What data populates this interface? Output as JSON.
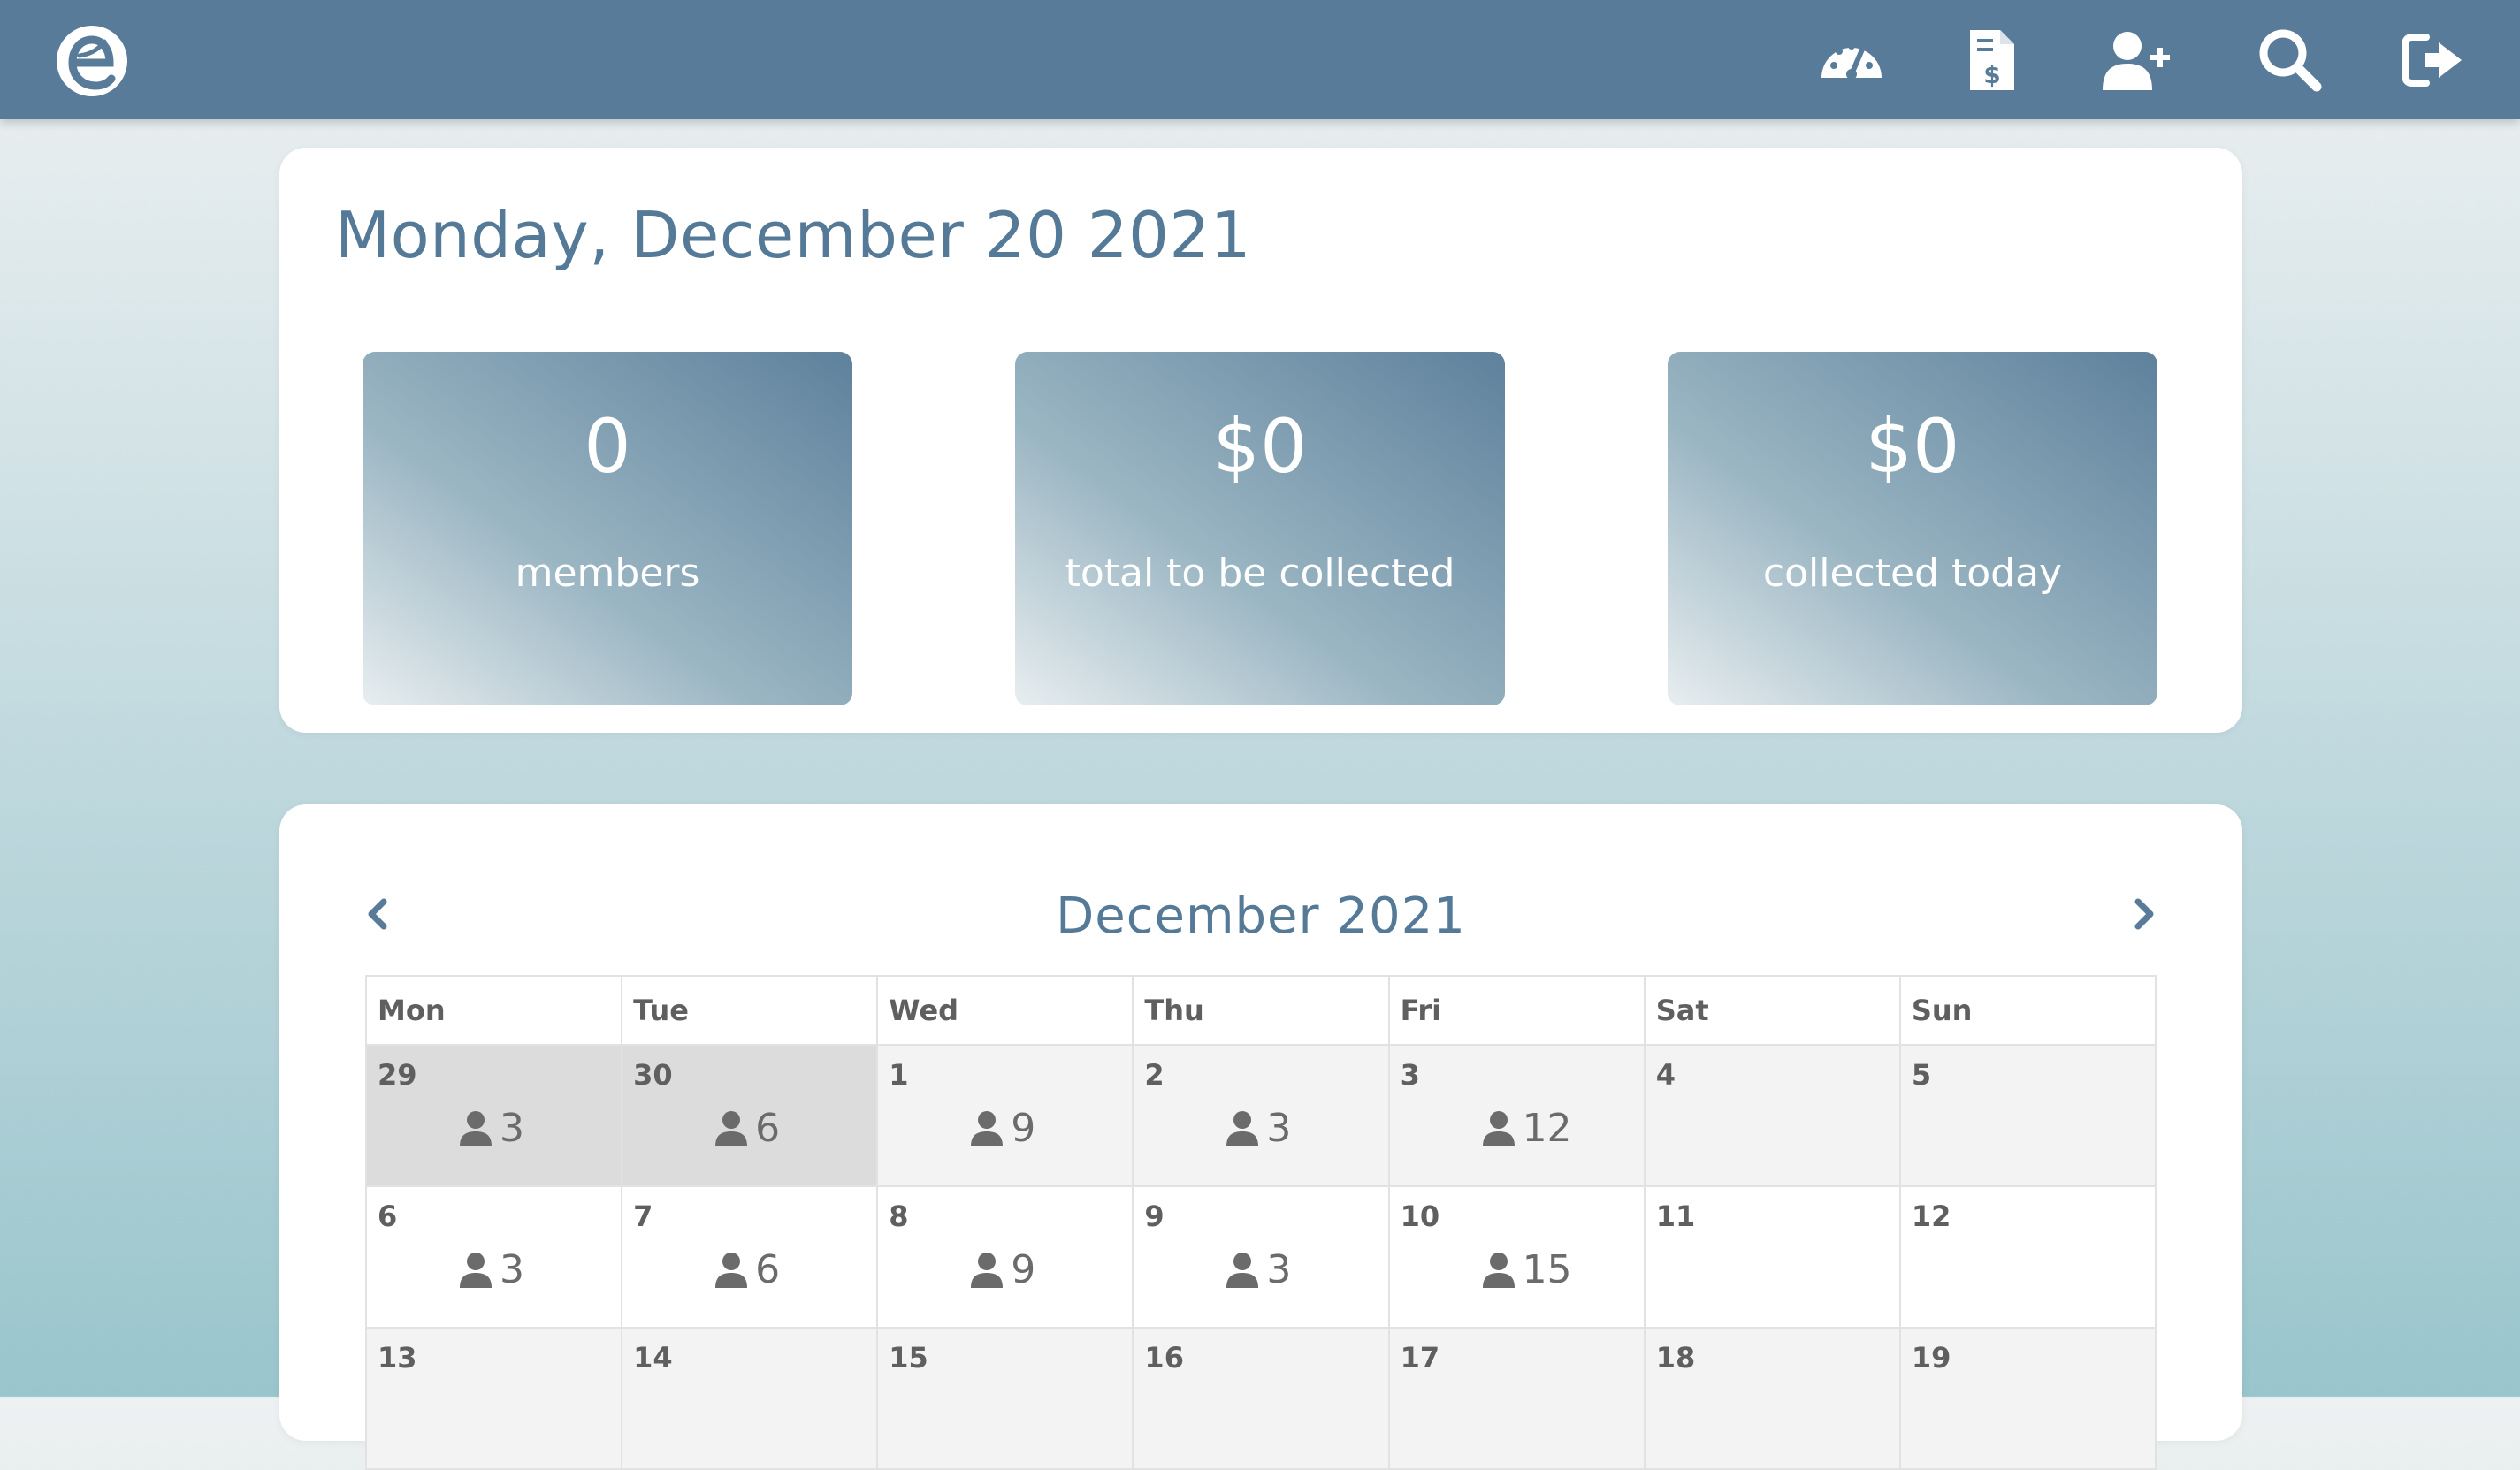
{
  "header": {
    "logo_letter": "e",
    "brand_color": "#587b99",
    "nav": [
      {
        "icon": "dashboard-gauge-icon"
      },
      {
        "icon": "invoice-dollar-icon"
      },
      {
        "icon": "add-user-icon"
      },
      {
        "icon": "search-icon"
      },
      {
        "icon": "logout-icon"
      }
    ]
  },
  "summary": {
    "date_title": "Monday, December 20 2021",
    "stats": [
      {
        "value": "0",
        "label": "members"
      },
      {
        "value": "$0",
        "label": "total to be collected"
      },
      {
        "value": "$0",
        "label": "collected today"
      }
    ]
  },
  "calendar": {
    "title": "December 2021",
    "prev_icon": "chevron-left-icon",
    "next_icon": "chevron-right-icon",
    "weekdays": [
      "Mon",
      "Tue",
      "Wed",
      "Thu",
      "Fri",
      "Sat",
      "Sun"
    ],
    "weeks": [
      [
        {
          "day": "29",
          "count": "3"
        },
        {
          "day": "30",
          "count": "6"
        },
        {
          "day": "1",
          "count": "9"
        },
        {
          "day": "2",
          "count": "3"
        },
        {
          "day": "3",
          "count": "12"
        },
        {
          "day": "4",
          "count": ""
        },
        {
          "day": "5",
          "count": ""
        }
      ],
      [
        {
          "day": "6",
          "count": "3"
        },
        {
          "day": "7",
          "count": "6"
        },
        {
          "day": "8",
          "count": "9"
        },
        {
          "day": "9",
          "count": "3"
        },
        {
          "day": "10",
          "count": "15"
        },
        {
          "day": "11",
          "count": ""
        },
        {
          "day": "12",
          "count": ""
        }
      ],
      [
        {
          "day": "13",
          "count": ""
        },
        {
          "day": "14",
          "count": ""
        },
        {
          "day": "15",
          "count": ""
        },
        {
          "day": "16",
          "count": ""
        },
        {
          "day": "17",
          "count": ""
        },
        {
          "day": "18",
          "count": ""
        },
        {
          "day": "19",
          "count": ""
        }
      ]
    ]
  }
}
